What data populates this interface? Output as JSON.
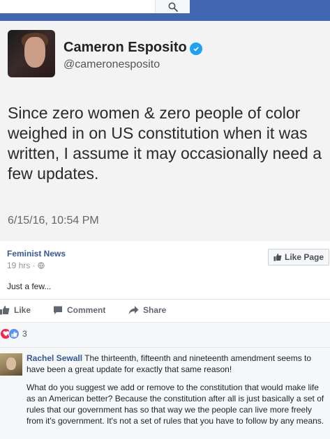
{
  "search": {
    "placeholder": ""
  },
  "tweet": {
    "name": "Cameron Esposito",
    "handle": "@cameronesposito",
    "text": "Since zero women & zero people of color weighed in on US constitution when it was written, I assume it may occasionally need a few updates.",
    "date": "6/15/16, 10:54 PM"
  },
  "post": {
    "page_name": "Feminist News",
    "time": "19 hrs ·",
    "like_page_label": "Like Page",
    "text": "Just a few..."
  },
  "actions": {
    "like": "Like",
    "comment": "Comment",
    "share": "Share"
  },
  "reactions": {
    "count": "3"
  },
  "comment": {
    "author": "Rachel Sewall",
    "text1": "The thirteenth, fifteenth and nineteenth amendment seems to have been a great update for exactly that same reason!",
    "text2": "What do you suggest we add or remove to the constitution that would make life as an American better? Because the constitution after all is just basically a set of rules that our government has so that way we the people can live more freely from it's government. It's not a set of rules that you have to follow by any means."
  },
  "colors": {
    "topbar": "#4267b2",
    "link": "#365899",
    "verified": "#1da1f2",
    "heart": "#f0284a",
    "like_reaction": "#5890ff"
  }
}
